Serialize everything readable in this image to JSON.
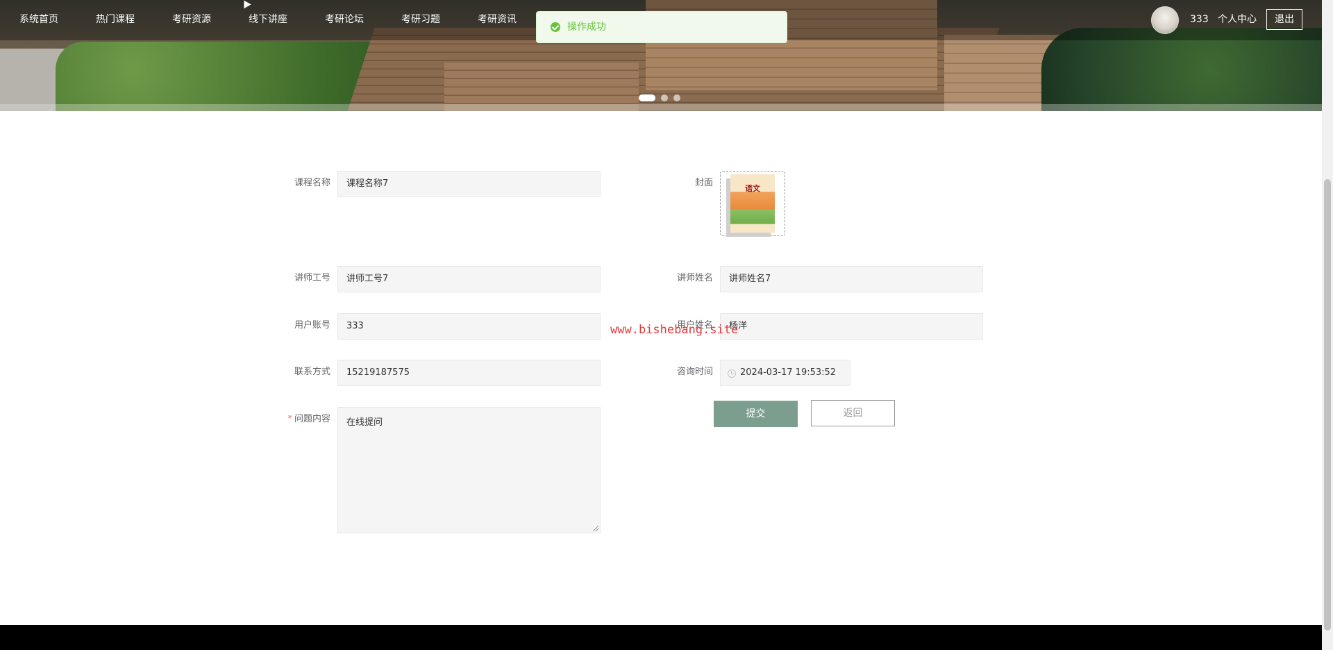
{
  "nav": {
    "items": [
      "系统首页",
      "热门课程",
      "考研资源",
      "线下讲座",
      "考研论坛",
      "考研习题",
      "考研资讯"
    ],
    "username": "333",
    "personal_center": "个人中心",
    "logout": "退出"
  },
  "toast": {
    "message": "操作成功",
    "icon": "success-check-icon",
    "color": "#67c23a"
  },
  "carousel": {
    "slides": 3,
    "active_index": 0
  },
  "form": {
    "course_name": {
      "label": "课程名称",
      "value": "课程名称7"
    },
    "cover": {
      "label": "封面",
      "image_text": "语文"
    },
    "teacher_id": {
      "label": "讲师工号",
      "value": "讲师工号7"
    },
    "teacher_name": {
      "label": "讲师姓名",
      "value": "讲师姓名7"
    },
    "user_account": {
      "label": "用户账号",
      "value": "333"
    },
    "user_name": {
      "label": "用户姓名",
      "value": "杨洋"
    },
    "contact": {
      "label": "联系方式",
      "value": "15219187575"
    },
    "consult_time": {
      "label": "咨询时间",
      "value": "2024-03-17 19:53:52"
    },
    "question": {
      "label": "问题内容",
      "required_mark": "*",
      "value": "在线提问"
    }
  },
  "buttons": {
    "submit": "提交",
    "back": "返回"
  },
  "watermark": "www.bishebang.site",
  "colors": {
    "primary": "#7c9e8e",
    "success": "#67c23a",
    "required": "#f56c6c",
    "watermark": "#e23a3a"
  }
}
